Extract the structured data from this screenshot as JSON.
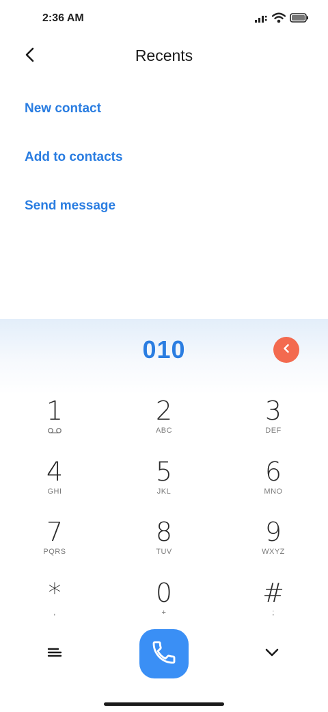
{
  "status_bar": {
    "time": "2:36 AM",
    "icons": [
      "signal-icon",
      "wifi-icon",
      "battery-icon"
    ]
  },
  "header": {
    "title": "Recents",
    "back_icon": "chevron-left-icon"
  },
  "actions": {
    "new_contact": "New contact",
    "add_to_contacts": "Add to contacts",
    "send_message": "Send message"
  },
  "dialer": {
    "number": "010",
    "delete_icon": "backspace-icon",
    "keys": [
      {
        "digit": "1",
        "letters": "",
        "sub_icon": "voicemail-icon"
      },
      {
        "digit": "2",
        "letters": "ABC"
      },
      {
        "digit": "3",
        "letters": "DEF"
      },
      {
        "digit": "4",
        "letters": "GHI"
      },
      {
        "digit": "5",
        "letters": "JKL"
      },
      {
        "digit": "6",
        "letters": "MNO"
      },
      {
        "digit": "7",
        "letters": "PQRS"
      },
      {
        "digit": "8",
        "letters": "TUV"
      },
      {
        "digit": "9",
        "letters": "WXYZ"
      },
      {
        "digit": "*",
        "letters": ","
      },
      {
        "digit": "0",
        "letters": "+"
      },
      {
        "digit": "#",
        "letters": ";"
      }
    ],
    "bottom_icons": [
      "menu-icon",
      "phone-icon",
      "chevron-down-icon"
    ]
  },
  "colors": {
    "accent": "#2a7de1",
    "call_button": "#3a8ff5",
    "delete_button": "#f36a4f"
  }
}
